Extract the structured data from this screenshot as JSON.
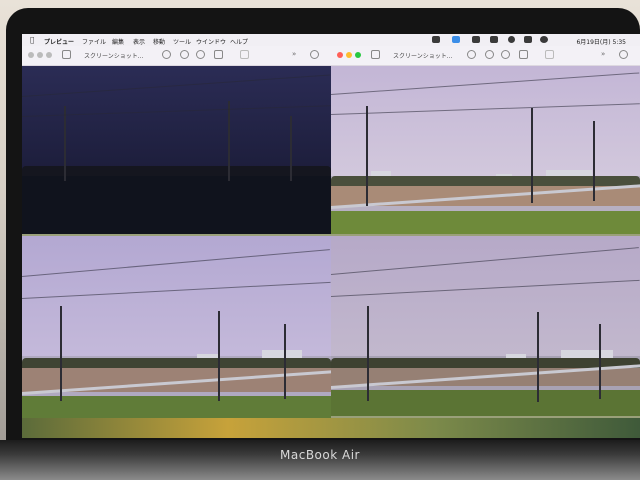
{
  "menubar": {
    "app": "プレビュー",
    "items": [
      "ファイル",
      "編集",
      "表示",
      "移動",
      "ツール",
      "ウインドウ",
      "ヘルプ"
    ],
    "clock": "6月19日(月) 5:35"
  },
  "windows": [
    {
      "title": "スクリーンショット...",
      "tone": "dark"
    },
    {
      "title": "スクリーンショット...",
      "tone": "light"
    },
    {
      "title": "",
      "tone": "mid"
    },
    {
      "title": "",
      "tone": "mid2"
    }
  ],
  "device": {
    "brand": "MacBook Air"
  },
  "colors": {
    "close": "#ff5f57",
    "minimize": "#febc2e",
    "zoom": "#28c840",
    "dark_sky": "#1e1f3c",
    "light_sky": "#c9bdd8",
    "mid_sky": "#b8b0d4"
  }
}
